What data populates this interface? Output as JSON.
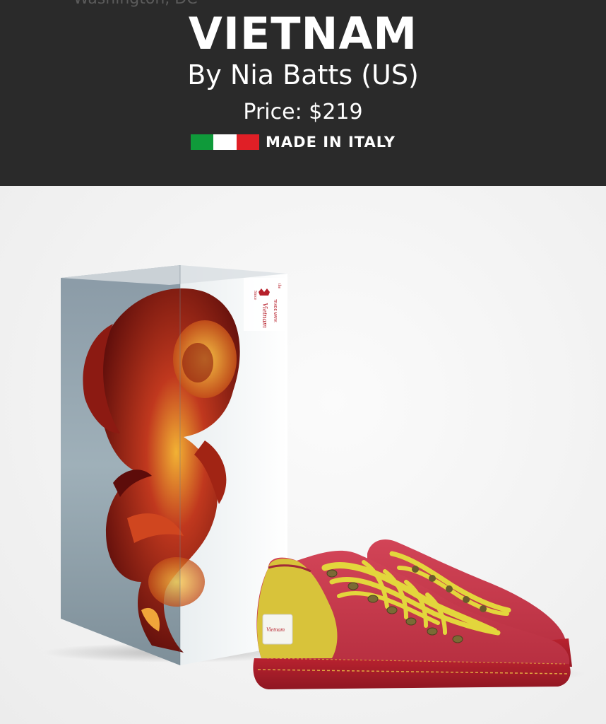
{
  "header": {
    "top_ghost_text": "Washington, DC",
    "title": "VIETNAM",
    "designer": "By Nia Batts (US)",
    "price": "Price: $219",
    "made_in": "MADE IN ITALY",
    "flag_colors": [
      "#0f9a3a",
      "#ffffff",
      "#e01f26"
    ]
  },
  "box": {
    "label_text": "Vietnam",
    "label_small_left": "Since",
    "label_small_right": "the",
    "label_sub": "TRADE MARK"
  },
  "shoe": {
    "tag_text": "Vietnam",
    "body_color": "#c8374a",
    "sole_color": "#b3202c",
    "accent_color": "#d8c33a",
    "lace_color": "#e3d63c"
  }
}
